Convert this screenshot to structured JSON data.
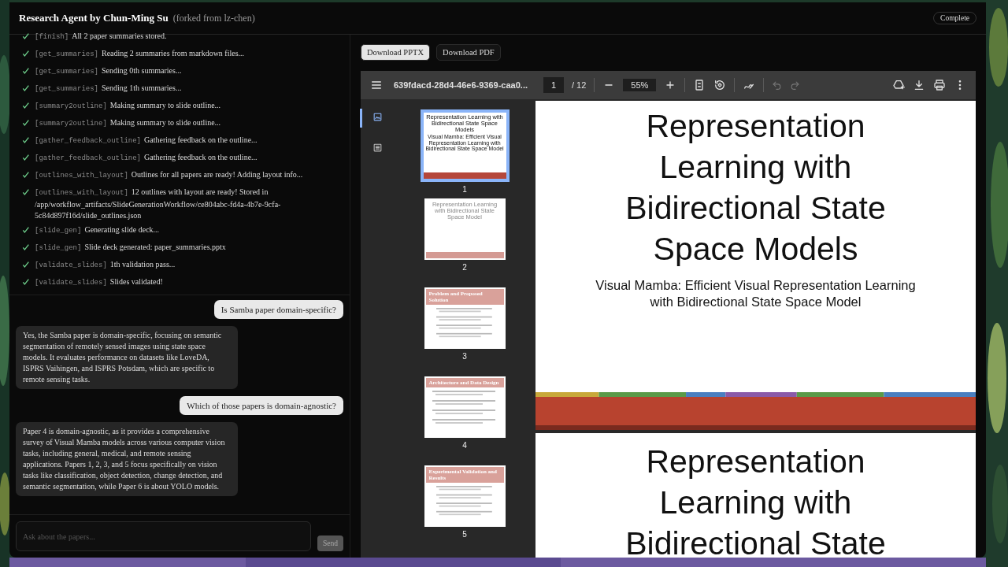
{
  "window": {
    "title": "Research Agent by Chun-Ming Su",
    "subtitle": "(forked from lz-chen)",
    "status": "Complete"
  },
  "log": [
    {
      "tag": "[finish]",
      "message": "All 2 paper summaries stored.",
      "done": true
    },
    {
      "tag": "[get_summaries]",
      "message": "Reading 2 summaries from markdown files...",
      "done": true
    },
    {
      "tag": "[get_summaries]",
      "message": "Sending 0th summaries...",
      "done": true
    },
    {
      "tag": "[get_summaries]",
      "message": "Sending 1th summaries...",
      "done": true
    },
    {
      "tag": "[summary2outline]",
      "message": "Making summary to slide outline...",
      "done": true
    },
    {
      "tag": "[summary2outline]",
      "message": "Making summary to slide outline...",
      "done": true
    },
    {
      "tag": "[gather_feedback_outline]",
      "message": "Gathering feedback on the outline...",
      "done": true
    },
    {
      "tag": "[gather_feedback_outline]",
      "message": "Gathering feedback on the outline...",
      "done": true
    },
    {
      "tag": "[outlines_with_layout]",
      "message": "Outlines for all papers are ready! Adding layout info...",
      "done": true
    },
    {
      "tag": "[outlines_with_layout]",
      "message": "12 outlines with layout are ready! Stored in /app/workflow_artifacts/SlideGenerationWorkflow/ce804abc-fd4a-4b7e-9cfa-5c84d897f16d/slide_outlines.json",
      "done": true
    },
    {
      "tag": "[slide_gen]",
      "message": "Generating slide deck...",
      "done": true
    },
    {
      "tag": "[slide_gen]",
      "message": "Slide deck generated: paper_summaries.pptx",
      "done": true
    },
    {
      "tag": "[validate_slides]",
      "message": "1th validation pass...",
      "done": true
    },
    {
      "tag": "[validate_slides]",
      "message": "Slides validated!",
      "done": true
    }
  ],
  "messages": [
    {
      "kind": "user",
      "text": "Is Samba paper domain-specific?"
    },
    {
      "kind": "assistant",
      "text": "Yes, the Samba paper is domain-specific, focusing on semantic segmentation of remotely sensed images using state space models. It evaluates performance on datasets like LoveDA, ISPRS Vaihingen, and ISPRS Potsdam, which are specific to remote sensing tasks."
    },
    {
      "kind": "user",
      "text": "Which of those papers is domain-agnostic?"
    },
    {
      "kind": "assistant",
      "text": "Paper 4 is domain-agnostic, as it provides a comprehensive survey of Visual Mamba models across various computer vision tasks, including general, medical, and remote sensing applications. Papers 1, 2, 3, and 5 focus specifically on vision tasks like classification, object detection, change detection, and semantic segmentation, while Paper 6 is about YOLO models."
    }
  ],
  "chat_input": {
    "placeholder": "Ask about the papers...",
    "send": "Send"
  },
  "downloads": [
    {
      "label": "Download PPTX",
      "selected": true
    },
    {
      "label": "Download PDF",
      "selected": false
    }
  ],
  "viewer": {
    "file_name": "639fdacd-28d4-46e6-9369-caa0...",
    "page": "1",
    "page_count": "/ 12",
    "zoom": "55%",
    "sidebar_tabs": [
      {
        "kind": "thumbnails",
        "selected": true
      },
      {
        "kind": "outline",
        "selected": false
      }
    ],
    "thumbnails": [
      {
        "kind": "title",
        "title": "Representation Learning with Bidirectional State Space Models",
        "subtitle": "Visual Mamba: Efficient Visual Representation Learning with Bidirectional State Space Model",
        "number": "1",
        "selected": true
      },
      {
        "kind": "cover",
        "title": "Representation Learning with Bidirectional State Space Model",
        "number": "2",
        "selected": false
      },
      {
        "kind": "section",
        "title": "Problem and Proposed Solution",
        "number": "3",
        "selected": false
      },
      {
        "kind": "section",
        "title": "Architecture and Data Design",
        "number": "4",
        "selected": false
      },
      {
        "kind": "section",
        "title": "Experimental Validation and Results",
        "number": "5",
        "selected": false
      }
    ],
    "pages": [
      {
        "title": "Representation Learning with Bidirectional State Space Models",
        "subtitle": "Visual Mamba: Efficient Visual Representation Learning with Bidirectional State Space Model"
      },
      {
        "title": "Representation Learning with Bidirectional State"
      }
    ]
  }
}
